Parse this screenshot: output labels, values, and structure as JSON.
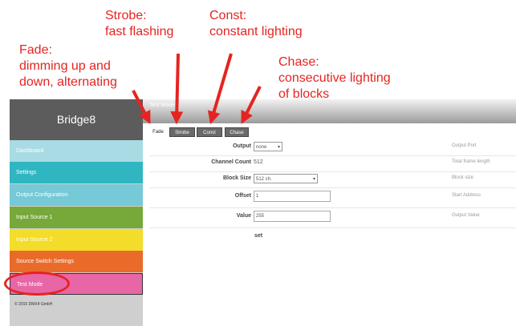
{
  "annotations": {
    "fade": [
      "Fade:",
      "dimming up and",
      "down, alternating"
    ],
    "strobe": [
      "Strobe:",
      "fast flashing"
    ],
    "const": [
      "Const:",
      "constant lighting"
    ],
    "chase": [
      "Chase:",
      "consecutive lighting",
      "of blocks"
    ],
    "color": "#e52421"
  },
  "app": {
    "brand": "Bridge8",
    "page_title": "Test Mode"
  },
  "sidebar": {
    "items": [
      {
        "label": "Dashboard",
        "color": "#a8dbe3"
      },
      {
        "label": "Settings",
        "color": "#2fb6c1"
      },
      {
        "label": "Output Configuration",
        "color": "#76c9d6"
      },
      {
        "label": "Input Source 1",
        "color": "#76a83a"
      },
      {
        "label": "Input Source 2",
        "color": "#f4dc2a"
      },
      {
        "label": "Source Switch Settings",
        "color": "#ea6a2a"
      },
      {
        "label": "Test Mode",
        "color": "#e866a6"
      }
    ],
    "copyright": "© 2015 DMX4 GmbH"
  },
  "tabs": [
    {
      "label": "Fade",
      "active": true
    },
    {
      "label": "Strobe",
      "active": false
    },
    {
      "label": "Const",
      "active": false
    },
    {
      "label": "Chase",
      "active": false
    }
  ],
  "form": {
    "output": {
      "label": "Output",
      "value": "none",
      "help": "Output Port"
    },
    "channel_count": {
      "label": "Channel Count",
      "value": "512",
      "help": "Total frame length"
    },
    "block_size": {
      "label": "Block Size",
      "value": "512 ch.",
      "help": "Block size"
    },
    "offset": {
      "label": "Offset",
      "value": "1",
      "help": "Start Address"
    },
    "value": {
      "label": "Value",
      "value": "255",
      "help": "Output Value"
    },
    "set_label": "set"
  }
}
